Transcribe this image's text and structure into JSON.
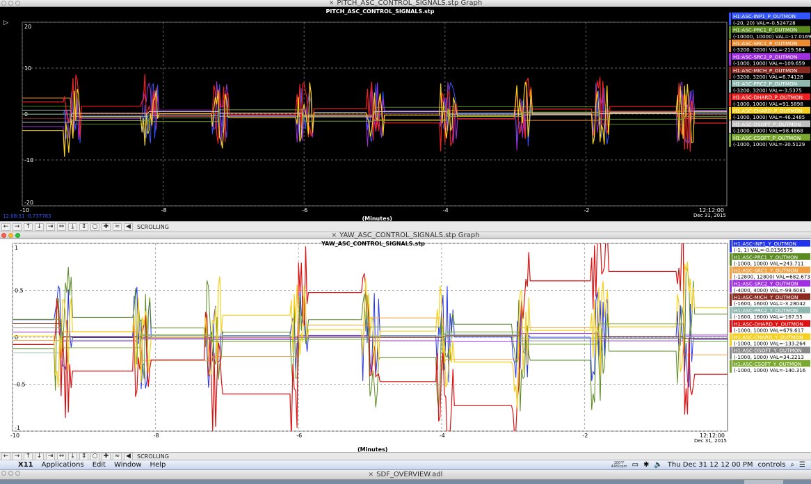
{
  "window_top": {
    "title": "PITCH_ASC_CONTROL_SIGNALS.stp Graph",
    "chart_title": "PITCH_ASC_CONTROL_SIGNALS.stp",
    "cursor_readout": "12:08:31 -0.737783"
  },
  "window_bottom": {
    "title": "YAW_ASC_CONTROL_SIGNALS.stp Graph",
    "chart_title": "YAW_ASC_CONTROL_SIGNALS.stp"
  },
  "window_third": {
    "title": "SDF_OVERVIEW.adl"
  },
  "toolbar": {
    "scrolling_label": "SCROLLING"
  },
  "menubar": {
    "apple": "",
    "app": "X11",
    "items": [
      "Applications",
      "Edit",
      "Window",
      "Help"
    ],
    "temp": "100°F",
    "rpm": "4481rpm",
    "clock": "Thu Dec 31  12 12 00 PM",
    "user": "controls"
  },
  "chart_data": [
    {
      "type": "line",
      "title": "PITCH_ASC_CONTROL_SIGNALS.stp",
      "xlabel": "(Minutes)",
      "x_ticks": [
        "-10",
        "-8",
        "-6",
        "-4",
        "-2"
      ],
      "x_end_label": [
        "12:12:00",
        "Dec 31, 2015"
      ],
      "xlim": [
        -10,
        0
      ],
      "ylim": [
        -20,
        20
      ],
      "y_ticks": [
        "20",
        "10",
        "0",
        "-10",
        "-20"
      ],
      "background": "#000000",
      "grid": true,
      "legend_position": "right",
      "series": [
        {
          "name": "H1:ASC-INP1_P_OUTMON",
          "range": "(-20, 20) VAL=-0.524728",
          "color": "#3355ff"
        },
        {
          "name": "H1:ASC-PRC1_P_OUTMON",
          "range": "(-10000, 10000) VAL=-17.0169",
          "color": "#5a8a20"
        },
        {
          "name": "H1:ASC-SRC1_P_OUTMON",
          "range": "(-3200, 3200) VAL=-219.584",
          "color": "#ee8a30"
        },
        {
          "name": "H1:ASC-SRC2_P_OUTMON",
          "range": "(-1000, 1000) VAL=-109.659",
          "color": "#a030e0"
        },
        {
          "name": "H1:ASC-MICH_P_OUTMON",
          "range": "(-3200, 3200) VAL=6.74128",
          "color": "#8a2a20"
        },
        {
          "name": "H1:ASC-PRC2_P_OUTMON",
          "range": "(-3200, 3200) VAL=-3.5375",
          "color": "#8fb8b0"
        },
        {
          "name": "H1:ASC-DHARD_P_OUTMON",
          "range": "(-1000, 1000) VAL=91.5898",
          "color": "#ee2222"
        },
        {
          "name": "H1:ASC-CHARD_P_OUTMON",
          "range": "(-1000, 1000) VAL=-46.2485",
          "color": "#f5d020"
        },
        {
          "name": "H1:ASC-DSOFT_P_OUTMON",
          "range": "(-1000, 1000) VAL=98.4868",
          "color": "#c0c0c0"
        },
        {
          "name": "H1:ASC-CSOFT_P_OUTMON",
          "range": "(-1000, 1000) VAL=-30.5129",
          "color": "#7aa830"
        }
      ]
    },
    {
      "type": "line",
      "title": "YAW_ASC_CONTROL_SIGNALS.stp",
      "xlabel": "(Minutes)",
      "x_ticks": [
        "-10",
        "-8",
        "-6",
        "-4",
        "-2"
      ],
      "x_end_label": [
        "12:12:00",
        "Dec 31, 2015"
      ],
      "xlim": [
        -10,
        0
      ],
      "ylim": [
        -1,
        1
      ],
      "y_ticks": [
        "1",
        "0.5",
        "0",
        "-0.5",
        "-1"
      ],
      "background": "#ffffff",
      "grid": true,
      "legend_position": "right",
      "series": [
        {
          "name": "H1:ASC-INP1_Y_OUTMON",
          "range": "(-1, 1) VAL=-0.0156575",
          "color": "#2233ee"
        },
        {
          "name": "H1:ASC-PRC1_Y_OUTMON",
          "range": "(-1000, 1000) VAL=243.711",
          "color": "#5a8a20"
        },
        {
          "name": "H1:ASC-SRC1_Y_OUTMON",
          "range": "(-12800, 12800) VAL=682.673",
          "color": "#f0a040"
        },
        {
          "name": "H1:ASC-SRC2_Y_OUTMON",
          "range": "(-4000, 4000) VAL=-99.6081",
          "color": "#a030e0"
        },
        {
          "name": "H1:ASC-MICH_Y_OUTMON",
          "range": "(-1600, 1600) VAL=-3.28042",
          "color": "#8a2a20"
        },
        {
          "name": "H1:ASC-PRC2_Y_OUTMON",
          "range": "(-1600, 1600) VAL=-167.55",
          "color": "#8fb8b0"
        },
        {
          "name": "H1:ASC-DHARD_Y_OUTMON",
          "range": "(-1000, 1000) VAL=679.617",
          "color": "#dd1111"
        },
        {
          "name": "H1:ASC-CHARD_Y_OUTMON",
          "range": "(-1000, 1000) VAL=-133.264",
          "color": "#f5d020"
        },
        {
          "name": "H1:ASC-DSOFT_Y_OUTMON",
          "range": "(-1000, 1000) VAL=34.2213",
          "color": "#8a8a8a"
        },
        {
          "name": "H1:ASC-CSOFT_Y_OUTMON",
          "range": "(-1000, 1000) VAL=-140.316",
          "color": "#7aa830"
        }
      ]
    }
  ]
}
